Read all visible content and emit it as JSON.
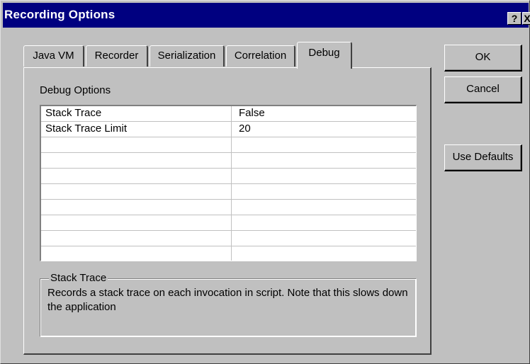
{
  "window": {
    "title": "Recording Options",
    "help_glyph": "?",
    "close_glyph": "X"
  },
  "tabs": [
    {
      "label": "Java VM",
      "active": false
    },
    {
      "label": "Recorder",
      "active": false
    },
    {
      "label": "Serialization",
      "active": false
    },
    {
      "label": "Correlation",
      "active": false
    },
    {
      "label": "Debug",
      "active": true
    }
  ],
  "debug": {
    "section_label": "Debug Options",
    "properties": [
      {
        "name": "Stack Trace",
        "value": "False"
      },
      {
        "name": "Stack Trace Limit",
        "value": "20"
      }
    ],
    "description": {
      "title": "Stack Trace",
      "text": "Records a stack trace on each invocation in script. Note that this slows down the application"
    }
  },
  "buttons": {
    "ok": "OK",
    "cancel": "Cancel",
    "use_defaults": "Use Defaults"
  },
  "colors": {
    "title_bar": "#000080",
    "face": "#c0c0c0"
  }
}
